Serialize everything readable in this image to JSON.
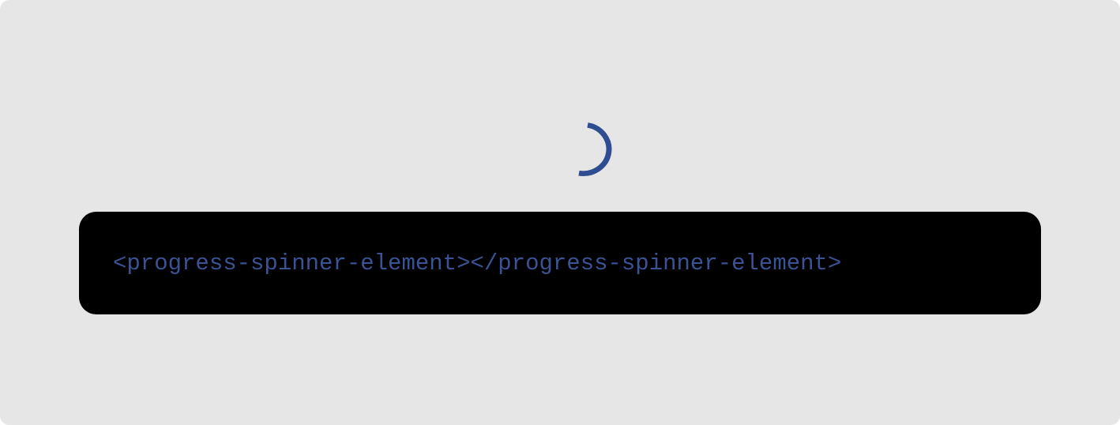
{
  "spinner": {
    "icon": "progress-spinner-icon",
    "color": "#2f4d91",
    "state": "loading"
  },
  "code_sample": {
    "text": "<progress-spinner-element></progress-spinner-element>",
    "text_color": "#3b5294",
    "background": "#000000"
  },
  "page": {
    "background": "#e6e6e6"
  }
}
